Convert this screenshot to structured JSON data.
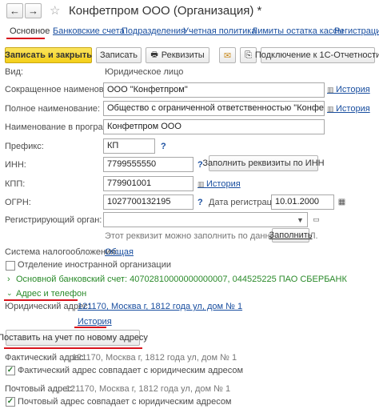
{
  "window": {
    "title": "Конфетпром ООО (Организация) *",
    "back_glyph": "←",
    "forward_glyph": "→",
    "star_glyph": "☆"
  },
  "tabs": [
    "Основное",
    "Банковские счета",
    "Подразделения",
    "Учетная политика",
    "Лимиты остатка кассы",
    "Регистрации в"
  ],
  "toolbar": {
    "save_close": "Записать и закрыть",
    "save": "Записать",
    "requisites": "Реквизиты",
    "connect": "Подключение к 1С-Отчетности"
  },
  "form": {
    "type_label": "Вид:",
    "type_value": "Юридическое лицо",
    "short_name_label": "Сокращенное наименование:",
    "short_name_value": "ООО \"Конфетпром\"",
    "full_name_label": "Полное наименование:",
    "full_name_value": "Общество с ограниченной ответственностью \"Конфетпром\"",
    "program_name_label": "Наименование в программе:",
    "program_name_value": "Конфетпром ООО",
    "prefix_label": "Префикс:",
    "prefix_value": "КП",
    "inn_label": "ИНН:",
    "inn_value": "7799555550",
    "fill_by_inn": "Заполнить реквизиты по ИНН",
    "kpp_label": "КПП:",
    "kpp_value": "779901001",
    "ogrn_label": "ОГРН:",
    "ogrn_value": "1027700132195",
    "reg_date_label": "Дата регистрации:",
    "reg_date_value": "10.01.2000",
    "reg_authority_label": "Регистрирующий орган:",
    "reg_hint": "Этот реквизит можно заполнить по данным ЕГРЮЛ.",
    "reg_fill_link": "Заполнить",
    "tax_system_label": "Система налогообложения:",
    "tax_system_link": "Общая",
    "foreign_branch": "Отделение иностранной организации",
    "bank_account": "Основной банковский счет: 40702810000000000007, 044525225 ПАО СБЕРБАНК",
    "address_section": "Адрес и телефон",
    "legal_address_label": "Юридический адрес:",
    "legal_address_value": "121170, Москва г, 1812 года ул, дом № 1",
    "history": "История",
    "register_new_address": "Поставить на учет по новому адресу",
    "actual_address_label": "Фактический адрес:",
    "actual_address_value": "121170, Москва г, 1812 года ул, дом № 1",
    "actual_same": "Фактический адрес совпадает с юридическим адресом",
    "postal_address_label": "Почтовый адрес:",
    "postal_address_value": "121170, Москва г, 1812 года ул, дом № 1",
    "postal_same": "Почтовый адрес совпадает с юридическим адресом",
    "question": "?"
  },
  "colors": {
    "accent_red": "#d8141d",
    "link": "#1a4fa0",
    "green": "#2a8a2a",
    "yellow_button": "#f4cf19"
  }
}
